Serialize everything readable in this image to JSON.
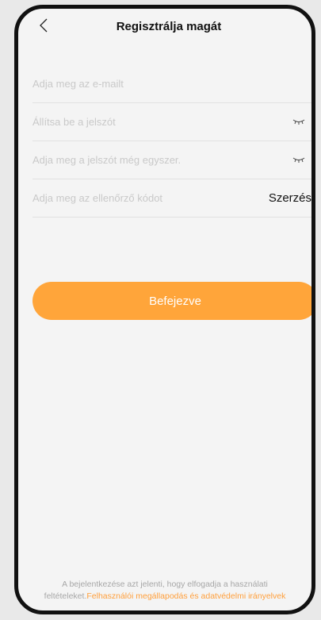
{
  "header": {
    "title": "Regisztrálja magát"
  },
  "form": {
    "email_placeholder": "Adja meg az e-mailt",
    "password_placeholder": "Állítsa be a jelszót",
    "password_confirm_placeholder": "Adja meg a jelszót még egyszer.",
    "code_placeholder": "Adja meg az ellenőrző kódot",
    "get_code_label": "Szerzés"
  },
  "submit_label": "Befejezve",
  "footer": {
    "text": "A bejelentkezése azt jelenti, hogy elfogadja a használati feltételeket.",
    "link": "Felhasználói megállapodás és adatvédelmi irányelvek"
  },
  "colors": {
    "accent": "#ffa53a",
    "link": "#ff9f3b"
  },
  "icons": {
    "back": "chevron-left-icon",
    "eye": "eye-closed-icon"
  }
}
